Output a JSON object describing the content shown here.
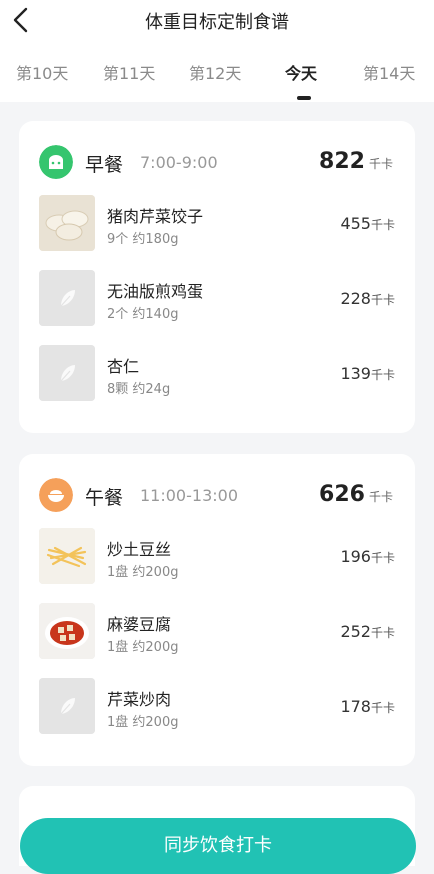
{
  "header": {
    "title": "体重目标定制食谱"
  },
  "tabs": [
    "第10天",
    "第11天",
    "第12天",
    "今天",
    "第14天"
  ],
  "colors": {
    "accent": "#21c2b4",
    "breakfast_icon": "#35c56e",
    "lunch_icon": "#f5a05a"
  },
  "meals": [
    {
      "name": "早餐",
      "time": "7:00-9:00",
      "kcal": "822",
      "unit": "千卡",
      "icon": "bread-icon",
      "items": [
        {
          "name": "猪肉芹菜饺子",
          "desc": "9个 约180g",
          "kcal": "455",
          "unit": "千卡",
          "image": "dumplings-photo"
        },
        {
          "name": "无油版煎鸡蛋",
          "desc": "2个 约140g",
          "kcal": "228",
          "unit": "千卡",
          "image": "placeholder-leaf-icon"
        },
        {
          "name": "杏仁",
          "desc": "8颗 约24g",
          "kcal": "139",
          "unit": "千卡",
          "image": "placeholder-leaf-icon"
        }
      ]
    },
    {
      "name": "午餐",
      "time": "11:00-13:00",
      "kcal": "626",
      "unit": "千卡",
      "icon": "rice-bowl-icon",
      "items": [
        {
          "name": "炒土豆丝",
          "desc": "1盘 约200g",
          "kcal": "196",
          "unit": "千卡",
          "image": "potato-shreds-photo"
        },
        {
          "name": "麻婆豆腐",
          "desc": "1盘 约200g",
          "kcal": "252",
          "unit": "千卡",
          "image": "mapo-tofu-photo"
        },
        {
          "name": "芹菜炒肉",
          "desc": "1盘 约200g",
          "kcal": "178",
          "unit": "千卡",
          "image": "placeholder-leaf-icon"
        }
      ]
    }
  ],
  "footer": {
    "button_label": "同步饮食打卡"
  }
}
